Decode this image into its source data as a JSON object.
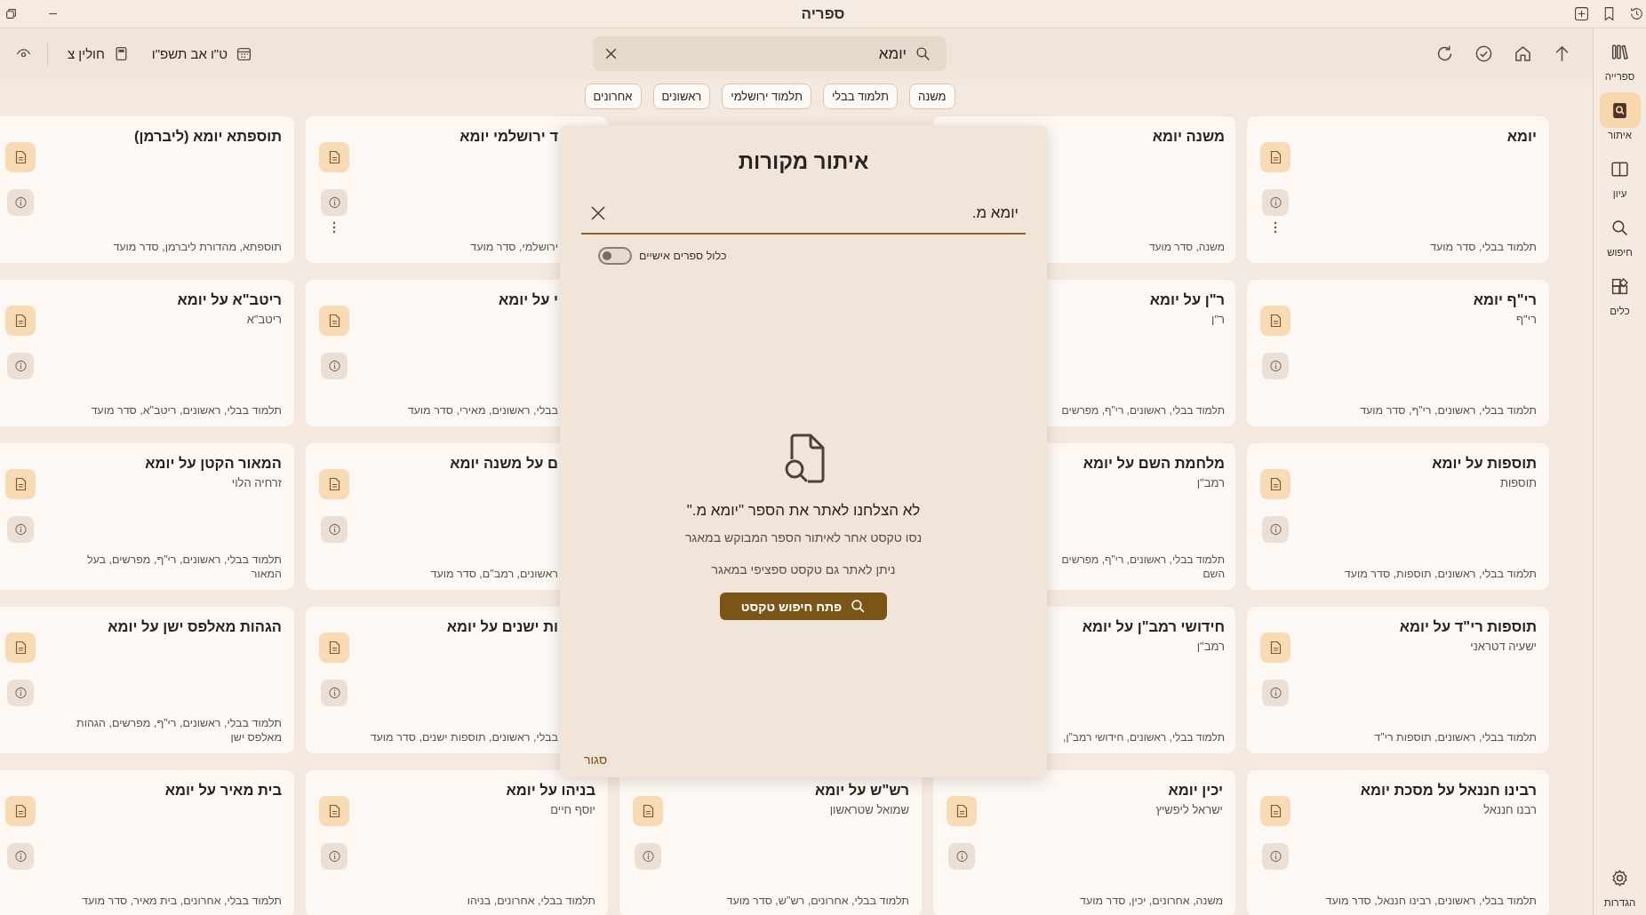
{
  "window": {
    "title": "ספריה"
  },
  "toolbar": {
    "daf": "חולין צ",
    "date": "ט\"ו אב תשפ\"ו",
    "search": {
      "value": "יומא"
    }
  },
  "filters": [
    {
      "label": "משנה"
    },
    {
      "label": "תלמוד בבלי"
    },
    {
      "label": "תלמוד ירושלמי"
    },
    {
      "label": "ראשונים"
    },
    {
      "label": "אחרונים"
    }
  ],
  "sidebar": {
    "items": [
      {
        "kind": "library",
        "label": "ספרייה",
        "selected": false
      },
      {
        "kind": "locate",
        "label": "איתור",
        "selected": true
      },
      {
        "kind": "study",
        "label": "עיון",
        "selected": false
      },
      {
        "kind": "search",
        "label": "חיפוש",
        "selected": false
      },
      {
        "kind": "tools",
        "label": "כלים",
        "selected": false
      }
    ],
    "settings": {
      "label": "הגדרות"
    }
  },
  "card_rows": [
    [
      {
        "title": "יומא",
        "footer": [
          "תלמוד בבלי, סדר מועד"
        ],
        "menu": true
      },
      {
        "title": "משנה יומא",
        "footer": [
          "משנה, סדר מועד"
        ]
      },
      {
        "title": "ד ירושלמי יומא",
        "footer": [
          "ירושלמי, סדר מועד"
        ],
        "menu": true
      },
      {
        "title": "תוספתא יומא (ליברמן)",
        "footer": [
          "תוספתא, מהדורת ליברמן, סדר מועד"
        ],
        "menu": false
      }
    ],
    [
      {
        "title": "רי\"ף יומא",
        "subtitle": "רי\"ף",
        "footer": [
          "תלמוד בבלי, ראשונים, רי\"ף, סדר מועד"
        ],
        "menu": false
      },
      {
        "title": "ר\"ן על יומא",
        "subtitle": "ר\"ן",
        "footer": [
          "תלמוד בבלי, ראשונים, רי\"ף, מפרשים"
        ]
      },
      {
        "title": "י על יומא",
        "footer": [
          "בבלי, ראשונים, מאירי, סדר מועד"
        ],
        "menu": false
      },
      {
        "title": "ריטב\"א על יומא",
        "subtitle": "ריטב\"א",
        "footer": [
          "תלמוד בבלי, ראשונים, ריטב\"א, סדר מועד"
        ],
        "menu": false
      }
    ],
    [
      {
        "title": "תוספות על יומא",
        "subtitle": "תוספות",
        "footer": [
          "תלמוד בבלי, ראשונים, תוספות, סדר מועד"
        ],
        "menu": false
      },
      {
        "title": "מלחמת השם על יומא",
        "subtitle": "רמב\"ן",
        "footer": [
          "תלמוד בבלי, ראשונים, רי\"ף, מפרשים",
          "השם"
        ]
      },
      {
        "title": "ם על משנה יומא",
        "footer": [
          "ראשונים, רמב\"ם, סדר מועד"
        ],
        "menu": false
      },
      {
        "title": "המאור הקטן על יומא",
        "subtitle": "זרחיה הלוי",
        "footer": [
          "תלמוד בבלי, ראשונים, רי\"ף, מפרשים, בעל",
          "המאור"
        ],
        "menu": false
      }
    ],
    [
      {
        "title": "תוספות רי\"ד על יומא",
        "subtitle": "ישעיה דטראני",
        "footer": [
          "תלמוד בבלי, ראשונים, תוספות רי\"ד"
        ],
        "menu": false
      },
      {
        "title": "חידושי רמב\"ן על יומא",
        "subtitle": "רמב\"ן",
        "footer": [
          "תלמוד בבלי, ראשונים, חידושי רמב\"ן,"
        ]
      },
      {
        "title": "ות ישנים על יומא",
        "footer": [
          "בבלי, ראשונים, תוספות ישנים, סדר מועד"
        ],
        "menu": false
      },
      {
        "title": "הגהות מאלפס ישן על יומא",
        "footer": [
          "תלמוד בבלי, ראשונים, רי\"ף, מפרשים, הגהות",
          "מאלפס ישן"
        ],
        "menu": false
      }
    ],
    [
      {
        "title": "רבינו חננאל על מסכת יומא",
        "subtitle": "רבנו חננאל",
        "footer": [
          "תלמוד בבלי, ראשונים, רבינו חננאל, סדר מועד"
        ],
        "menu": false
      },
      {
        "title": "יכין יומא",
        "subtitle": "ישראל ליפשיץ",
        "footer": [
          "משנה, אחרונים, יכין, סדר מועד"
        ],
        "menu": false
      },
      {
        "title": "רש\"ש על יומא",
        "subtitle": "שמואל שטראשון",
        "footer": [
          "תלמוד בבלי, אחרונים, רש\"ש, סדר מועד"
        ],
        "menu": false
      },
      {
        "title": "בניהו על יומא",
        "subtitle": "יוסף חיים",
        "footer": [
          "תלמוד בבלי, אחרונים, בניהו"
        ],
        "menu": false
      },
      {
        "title": "בית מאיר על יומא",
        "footer": [
          "תלמוד בבלי, אחרונים, בית מאיר, סדר מועד"
        ],
        "menu": false
      }
    ]
  ],
  "dialog": {
    "title": "איתור מקורות",
    "query": {
      "value": "יומא מ."
    },
    "toggle": {
      "label": "כלול ספרים אישיים",
      "on": false
    },
    "message": {
      "title": "לא הצלחנו לאתר את הספר \"יומא מ.\"",
      "lines": [
        "נסו טקסט אחר לאיתור הספר המבוקש במאגר",
        "ניתן לאתר גם טקסט ספציפי במאגר"
      ]
    },
    "button": "פתח חיפוש טקסט",
    "close": "סגור"
  }
}
